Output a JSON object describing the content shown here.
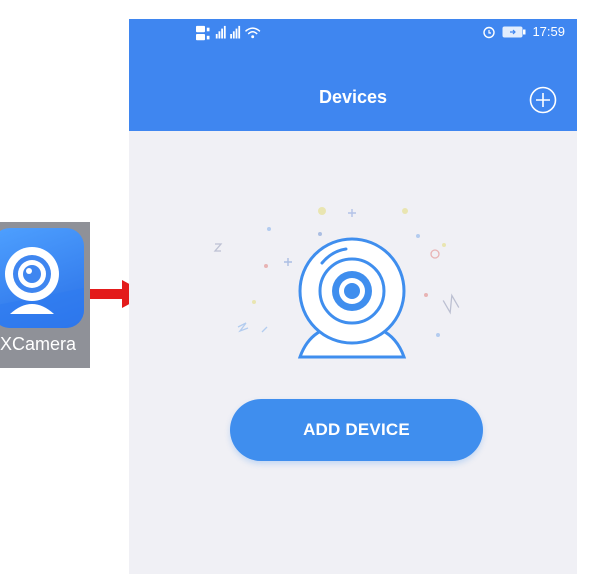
{
  "app_icon": {
    "label": "XCamera",
    "icon": "webcam-icon"
  },
  "status_bar": {
    "time": "17:59",
    "alarm_icon": "alarm-icon",
    "battery_icon": "battery-charging-icon",
    "signal_icon": "signal-icon",
    "wifi_icon": "wifi-icon",
    "hd_icon": "hd-icon"
  },
  "header": {
    "title": "Devices",
    "add_icon": "plus-circle-icon"
  },
  "main": {
    "add_device_label": "ADD DEVICE",
    "illustration_icon": "webcam-icon"
  },
  "colors": {
    "header": "#3f86f0",
    "button": "#3f8eee",
    "background": "#f0f0f5",
    "arrow": "#e31b1b"
  }
}
